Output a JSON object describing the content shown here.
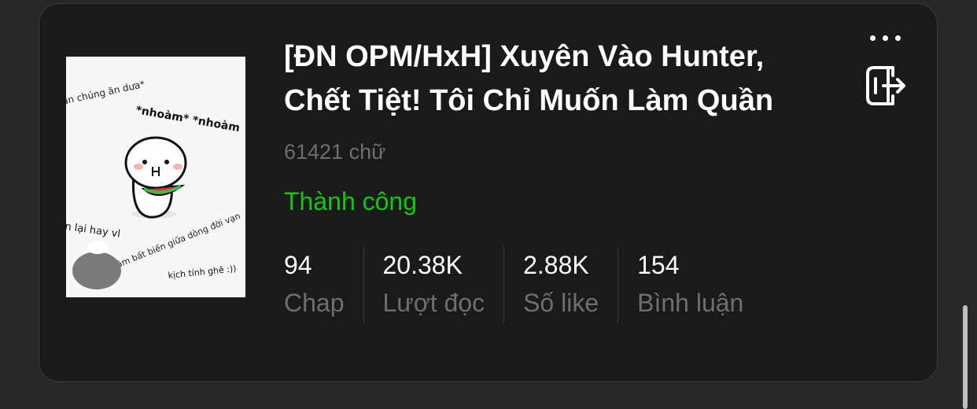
{
  "story": {
    "title": "[ĐN OPM/HxH] Xuyên Vào Hunter, Chết Tiệt! Tôi Chỉ Muốn Làm Quần",
    "word_count": "61421 chữ",
    "status": "Thành công",
    "status_color": "#12c812",
    "cover": {
      "text_1": "ần chúng ăn dưa*",
      "text_2": "*nhoàm* *nhoàm",
      "text_3": "n lại hay vl",
      "text_4": "tâm bất biến giữa dòng đời vạn",
      "text_5": "kịch tính ghê :))"
    }
  },
  "stats": [
    {
      "value": "94",
      "label": "Chap"
    },
    {
      "value": "20.38K",
      "label": "Lượt đọc"
    },
    {
      "value": "2.88K",
      "label": "Số like"
    },
    {
      "value": "154",
      "label": "Bình luận"
    }
  ],
  "actions": {
    "more_icon": "more-horizontal-icon",
    "exit_icon": "exit-icon"
  }
}
